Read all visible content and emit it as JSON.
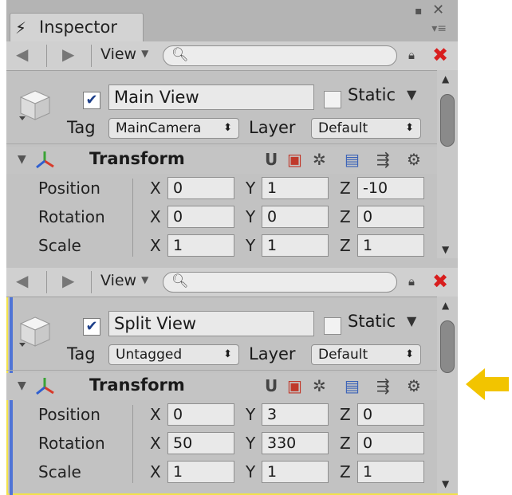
{
  "window": {
    "tab_title": "Inspector",
    "tab_icon": "lightning-icon",
    "minimize_glyph": "▪",
    "close_glyph": "✕",
    "menu_glyph": "▾≡"
  },
  "toolbar": {
    "back_glyph": "◀",
    "forward_glyph": "▶",
    "view_label": "View",
    "search_placeholder": "",
    "lock_glyph": "🔒",
    "close_glyph": "✖"
  },
  "panes": [
    {
      "id": "top",
      "active": true,
      "name": "Main View",
      "static_label": "Static",
      "static_checked": false,
      "tag_label": "Tag",
      "tag_value": "MainCamera",
      "layer_label": "Layer",
      "layer_value": "Default",
      "component_title": "Transform",
      "rows": [
        {
          "label": "Position",
          "x": "0",
          "y": "1",
          "z": "-10"
        },
        {
          "label": "Rotation",
          "x": "0",
          "y": "0",
          "z": "0"
        },
        {
          "label": "Scale",
          "x": "1",
          "y": "1",
          "z": "1"
        }
      ]
    },
    {
      "id": "bottom",
      "active": true,
      "focused": true,
      "name": "Split View",
      "static_label": "Static",
      "static_checked": false,
      "tag_label": "Tag",
      "tag_value": "Untagged",
      "layer_label": "Layer",
      "layer_value": "Default",
      "component_title": "Transform",
      "rows": [
        {
          "label": "Position",
          "x": "0",
          "y": "3",
          "z": "0"
        },
        {
          "label": "Rotation",
          "x": "50",
          "y": "330",
          "z": "0"
        },
        {
          "label": "Scale",
          "x": "1",
          "y": "1",
          "z": "1"
        }
      ]
    }
  ],
  "axis_labels": {
    "x": "X",
    "y": "Y",
    "z": "Z"
  },
  "icons": {
    "check": "✔",
    "foldout": "▼",
    "dropdown_arrow": "⬍",
    "static_caret": "▼",
    "tool_u": "U",
    "tool_cube": "▣",
    "tool_gear_cog": "✲",
    "tool_book": "▤",
    "tool_sliders": "⇶",
    "tool_settings": "⚙"
  },
  "colors": {
    "accent_close": "#d81e1e",
    "focus_outline": "#f2e24a",
    "focus_line": "#4f74d6",
    "callout_arrow": "#f2c400"
  }
}
